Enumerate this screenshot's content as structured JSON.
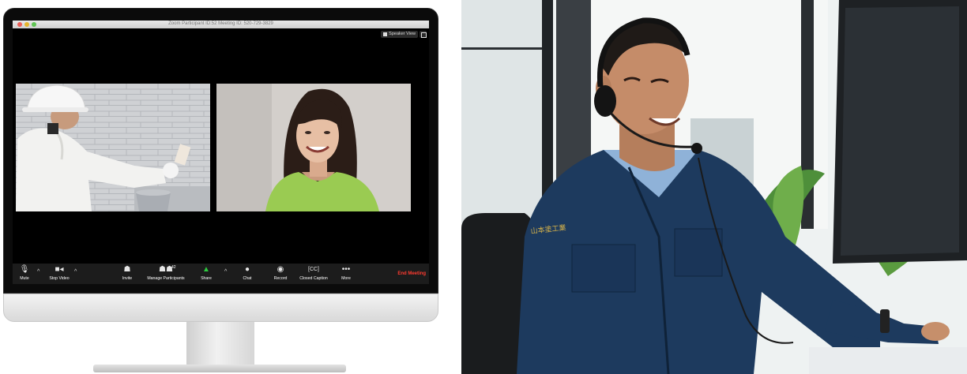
{
  "zoom": {
    "window_title": "Zoom Participant ID:52  Meeting ID: 520-729-3829",
    "speaker_view_label": "Speaker View",
    "participant_count": "42",
    "toolbar": {
      "mute": "Mute",
      "stop_video": "Stop Video",
      "invite": "Invite",
      "manage_participants": "Manage Participants",
      "share": "Share",
      "chat": "Chat",
      "record": "Record",
      "closed_caption": "Closed Caption",
      "more": "More",
      "end_meeting": "End Meeting"
    },
    "icons": {
      "mute": "microphone-icon",
      "stop_video": "video-camera-icon",
      "invite": "add-person-icon",
      "manage_participants": "participants-icon",
      "share": "share-screen-icon",
      "chat": "chat-bubble-icon",
      "record": "record-icon",
      "closed_caption": "cc-icon",
      "more": "ellipsis-icon"
    },
    "colors": {
      "end_meeting": "#ff3b30",
      "share_icon": "#2ecc40",
      "toolbar_bg": "#1c1c1c"
    }
  },
  "photo": {
    "jacket_embroidery": "山本塗工業"
  }
}
